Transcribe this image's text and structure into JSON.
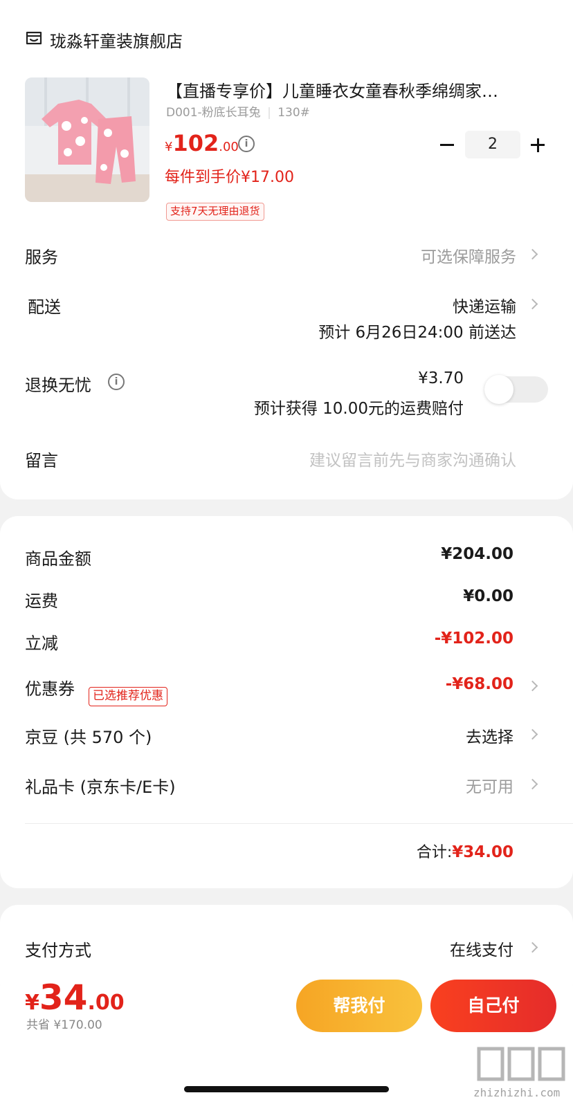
{
  "store": {
    "name": "珑淼轩童装旗舰店",
    "icon": "store-icon"
  },
  "product": {
    "title": "【直播专享价】儿童睡衣女童春秋季绵绸家…",
    "spec": "D001-粉底长耳兔",
    "size": "130#",
    "price_symbol": "¥",
    "price_int": "102",
    "price_dec": ".00",
    "unit_price": "每件到手价¥17.00",
    "return_tag": "支持7天无理由退货",
    "quantity": "2"
  },
  "rows": {
    "service": {
      "label": "服务",
      "value": "可选保障服务"
    },
    "delivery": {
      "label": "配送",
      "value": "快递运输",
      "eta": "预计 6月26日24:00 前送达"
    },
    "return_worry": {
      "label": "退换无忧",
      "price": "¥3.70",
      "desc": "预计获得 10.00元的运费赔付",
      "enabled": false
    },
    "note": {
      "label": "留言",
      "placeholder": "建议留言前先与商家沟通确认"
    }
  },
  "summary": {
    "goods": {
      "label": "商品金额",
      "value": "¥204.00"
    },
    "shipping": {
      "label": "运费",
      "value": "¥0.00"
    },
    "discount": {
      "label": "立减",
      "value": "-¥102.00"
    },
    "coupon": {
      "label": "优惠券",
      "tag": "已选推荐优惠",
      "value": "-¥68.00"
    },
    "jingdou": {
      "label": "京豆 (共 570 个)",
      "value": "去选择"
    },
    "giftcard": {
      "label": "礼品卡 (京东卡/E卡)",
      "value": "无可用"
    },
    "total_label": "合计:",
    "total_value": "¥34.00"
  },
  "payment": {
    "label": "支付方式",
    "value": "在线支付"
  },
  "bottom": {
    "symbol": "¥",
    "amount_int": "34",
    "amount_dec": ".00",
    "saved": "共省 ¥170.00",
    "help_pay": "帮我付",
    "self_pay": "自己付"
  },
  "watermark": {
    "text": "zhizhizhi.com"
  },
  "colors": {
    "accent": "#e2231a",
    "help_pay_btn": "#f7b733",
    "self_pay_btn": "#f2362a"
  }
}
